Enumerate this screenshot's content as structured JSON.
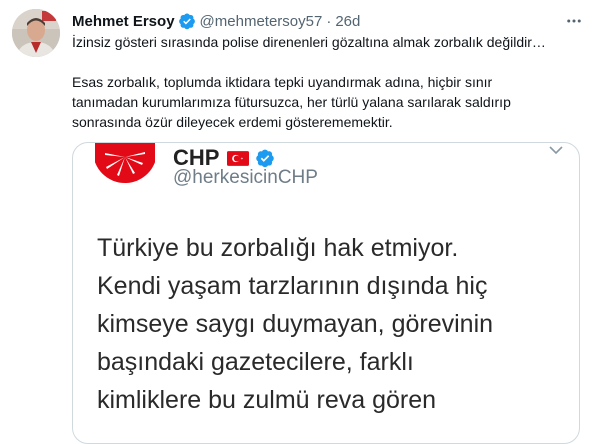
{
  "tweet": {
    "author_name": "Mehmet Ersoy",
    "handle": "@mehmetersoy57",
    "separator": "·",
    "time": "26d",
    "text_line1": "İzinsiz gösteri sırasında polise direnenleri gözaltına almak zorbalık değildir…",
    "text_para2": "Esas zorbalık, toplumda iktidara tepki uyandırmak adına, hiçbir sınır tanımadan kurumlarımıza fütursuzca, her türlü yalana sarılarak saldırıp sonrasında özür dileyecek erdemi gösterememektir."
  },
  "embedded_image": {
    "account_name": "CHP",
    "account_handle": "@herkesicinCHP",
    "lines": [
      "Türkiye bu zorbalığı hak etmiyor.",
      "Kendi yaşam tarzlarının dışında hiç",
      "kimseye saygı duymayan, görevinin",
      "başındaki gazetecilere, farklı",
      "kimliklere bu zulmü reva gören"
    ]
  },
  "colors": {
    "verified_blue": "#1d9bf0",
    "chp_red": "#e30a17",
    "secondary_text": "#536471"
  },
  "icons": [
    "avatar",
    "verified-badge-icon",
    "more-options-icon",
    "chp-logo-icon",
    "turkish-flag-icon",
    "chevron-down-icon"
  ]
}
